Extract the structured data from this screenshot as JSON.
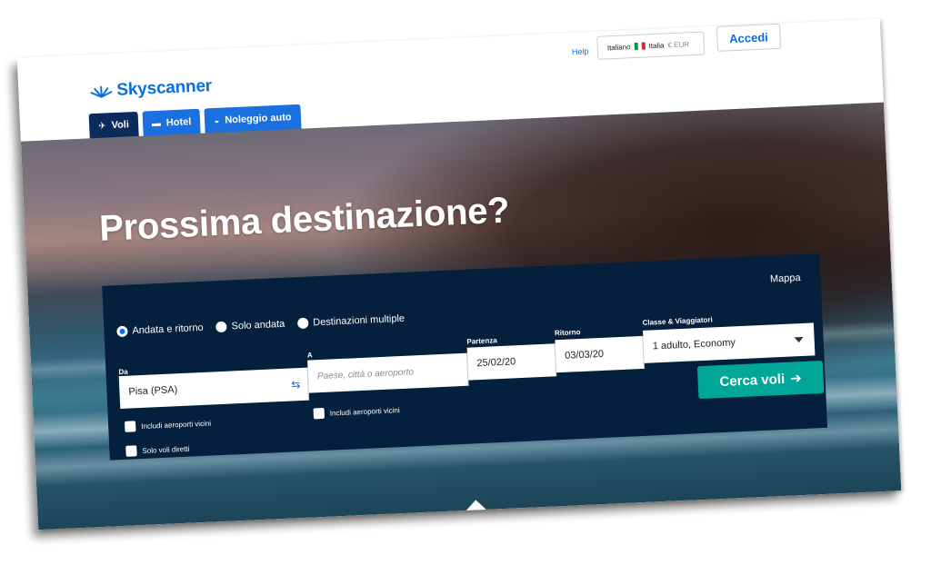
{
  "header": {
    "logo_text": "Skyscanner",
    "help_label": "Help",
    "locale": {
      "language": "Italiano",
      "country": "Italia",
      "currency": "€ EUR"
    },
    "login_label": "Accedi"
  },
  "tabs": [
    {
      "label": "Voli",
      "icon": "plane-icon",
      "active": true
    },
    {
      "label": "Hotel",
      "icon": "bed-icon",
      "active": false
    },
    {
      "label": "Noleggio auto",
      "icon": "car-icon",
      "active": false
    }
  ],
  "hero": {
    "title": "Prossima destinazione?"
  },
  "search": {
    "map_label": "Mappa",
    "trip_types": [
      {
        "label": "Andata e ritorno",
        "selected": true
      },
      {
        "label": "Solo andata",
        "selected": false
      },
      {
        "label": "Destinazioni multiple",
        "selected": false
      }
    ],
    "from": {
      "label": "Da",
      "value": "Pisa (PSA)"
    },
    "to": {
      "label": "A",
      "placeholder": "Paese, città o aeroporto"
    },
    "departure": {
      "label": "Partenza",
      "value": "25/02/20"
    },
    "return": {
      "label": "Ritorno",
      "value": "03/03/20"
    },
    "class_travellers": {
      "label": "Classe & Viaggiatori",
      "value": "1 adulto, Economy"
    },
    "nearby_from_label": "Includi aeroporti vicini",
    "nearby_to_label": "Includi aeroporti vicini",
    "direct_only_label": "Solo voli diretti",
    "submit_label": "Cerca voli"
  },
  "colors": {
    "brand_blue": "#0770e3",
    "panel_navy": "#05203c",
    "search_green": "#00a698",
    "active_tab": "#0a2b5c"
  }
}
